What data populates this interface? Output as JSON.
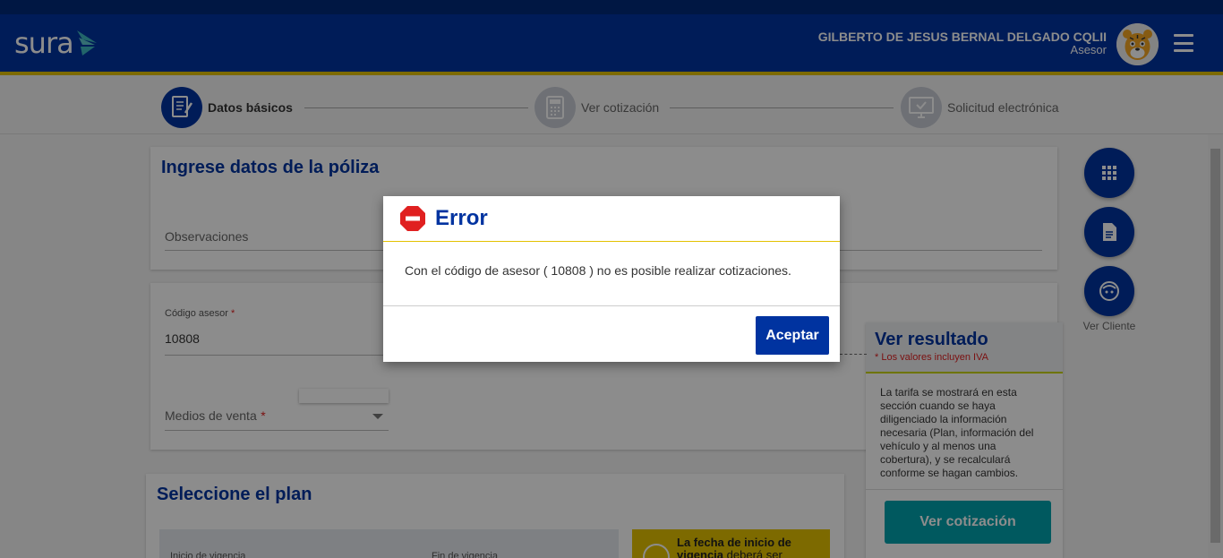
{
  "header": {
    "logo": "sura",
    "user_name": "GILBERTO DE JESUS BERNAL DELGADO CQLII",
    "user_role": "Asesor"
  },
  "stepper": {
    "steps": [
      {
        "label": "Datos básicos",
        "active": true
      },
      {
        "label": "Ver cotización",
        "active": false
      },
      {
        "label": "Solicitud electrónica",
        "active": false
      }
    ]
  },
  "poliza": {
    "title": "Ingrese datos de la póliza",
    "observaciones_label": "Observaciones"
  },
  "asesor": {
    "codigo_label": "Código asesor",
    "required_mark": "*",
    "codigo_value": "10808",
    "medios_label": "Medios de venta"
  },
  "plan": {
    "title": "Seleccione el plan",
    "inicio_label": "Inicio de vigencia",
    "fin_label": "Fin de vigencia",
    "notice_text_1": "La fecha de inicio de",
    "notice_bold": "vigencia",
    "notice_text_2": "deberá ser"
  },
  "resultado": {
    "title": "Ver resultado",
    "iva_note": "* Los valores incluyen IVA",
    "description": "La tarifa se mostrará en esta sección cuando se haya diligenciado la información necesaria (Plan, información del vehículo y al menos una cobertura), y se recalculará conforme se hagan cambios.",
    "button_label": "Ver cotización"
  },
  "fabs": {
    "ver_cliente_label": "Ver Cliente"
  },
  "modal": {
    "title": "Error",
    "message": "Con el código de asesor ( 10808 ) no es posible realizar cotizaciones.",
    "button_label": "Aceptar"
  },
  "colors": {
    "primary": "#0033a0",
    "accent_gold": "#e3c200",
    "teal": "#00a3ad",
    "error_red": "#e02020"
  }
}
